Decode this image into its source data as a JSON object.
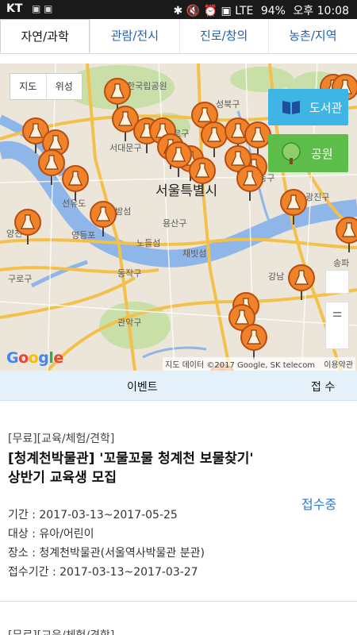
{
  "status_bar": {
    "carrier": "KT",
    "notif_icons": "▣ ▣",
    "right_icons": "✱ 🔇 ⏰ ▣ LTE",
    "battery": "94%",
    "time": "오후 10:08"
  },
  "tabs": [
    {
      "label": "자연/과학",
      "active": true
    },
    {
      "label": "관람/전시",
      "active": false
    },
    {
      "label": "진로/창의",
      "active": false
    },
    {
      "label": "농촌/지역",
      "active": false
    }
  ],
  "map": {
    "map_types": [
      "지도",
      "위성"
    ],
    "library_button": "도서관",
    "park_button": "공원",
    "labels": [
      "한국립공원",
      "성북구",
      "서대문구",
      "종로구",
      "서울특별시",
      "선유도",
      "영등포",
      "밤섬",
      "용산구",
      "노들섬",
      "채빗섬",
      "동작구",
      "관악구",
      "구로구",
      "양천",
      "광진구",
      "강남",
      "송파",
      "성동구"
    ],
    "google_logo": "Google",
    "attribution": "지도 데이터 ©2017 Google, SK telecom",
    "terms": "이용약관",
    "colors": {
      "pin": "#f0822a",
      "pin_dark": "#b84d10",
      "road": "#f3c04c",
      "river": "#8fb6e8",
      "land": "#ece6da",
      "park": "#c8dfa7"
    }
  },
  "list": {
    "header_event": "이벤트",
    "header_status": "접 수"
  },
  "event": {
    "tags": "[무료][교육/체험/견학]",
    "title_line1": "[청계천박물관] '꼬물꼬물 청계천 보물찾기'",
    "title_line2": "상반기 교육생 모집",
    "status": "접수중",
    "period": "기간 : 2017-03-13~2017-05-25",
    "target": "대상 : 유아/어린이",
    "place": "장소 : 청계천박물관(서울역사박물관 분관)",
    "reg_period": "접수기간 : 2017-03-13~2017-03-27"
  },
  "next_event": {
    "tags": "[무료][교육/체험/견학]"
  }
}
